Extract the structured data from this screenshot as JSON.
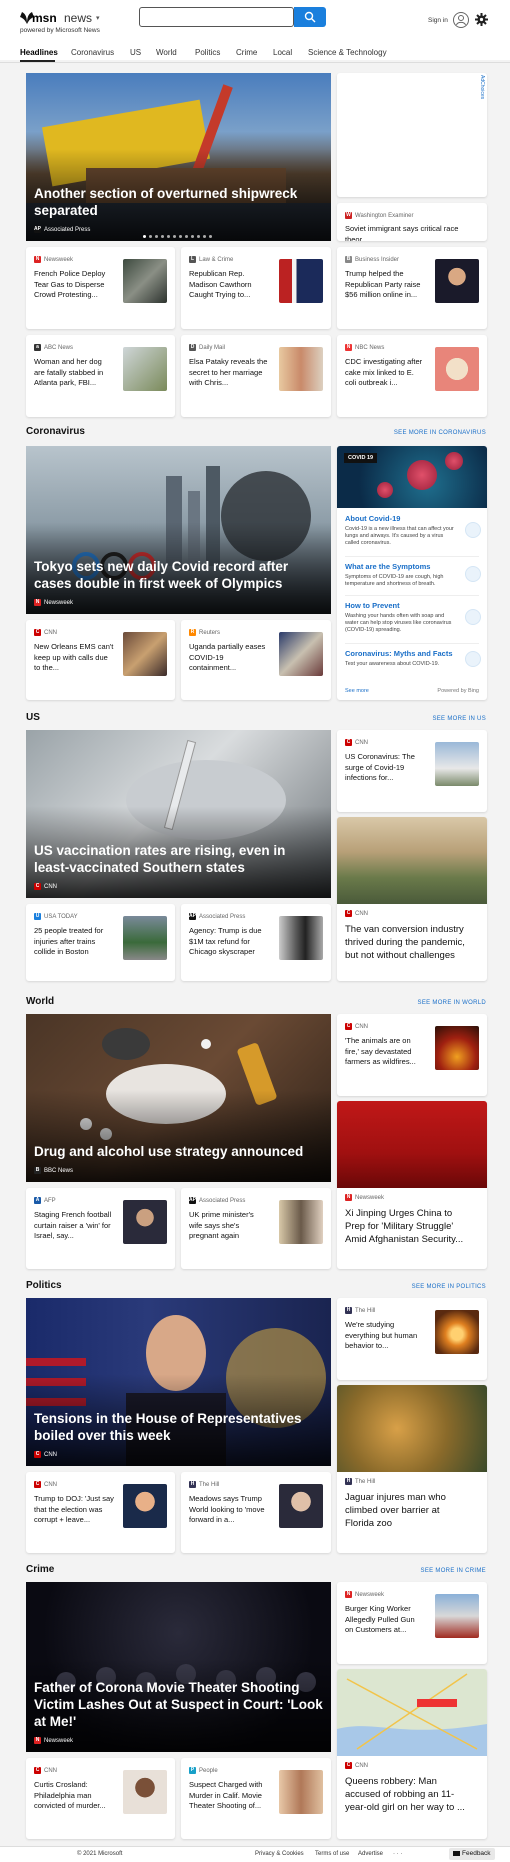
{
  "header": {
    "brand": "msn",
    "product": "news",
    "powered_by": "powered by Microsoft News",
    "search_placeholder": "",
    "sign_in": "Sign in"
  },
  "nav": [
    "Headlines",
    "Coronavirus",
    "US",
    "World",
    "Politics",
    "Crime",
    "Local",
    "Science & Technology"
  ],
  "ad_choices": "AdChoices",
  "top": {
    "hero_title": "Another section of overturned shipwreck separated",
    "hero_source": "Associated Press",
    "side_source": "Washington Examiner",
    "side_title": "Soviet immigrant says critical race theor...",
    "cards": [
      {
        "source": "Newsweek",
        "title": "French Police Deploy Tear Gas to Disperse Crowd Protesting..."
      },
      {
        "source": "Law & Crime",
        "title": "Republican Rep. Madison Cawthorn Caught Trying to..."
      },
      {
        "source": "Business Insider",
        "title": "Trump helped the Republican Party raise $56 million online in..."
      },
      {
        "source": "ABC News",
        "title": "Woman and her dog are fatally stabbed in Atlanta park, FBI..."
      },
      {
        "source": "Daily Mail",
        "title": "Elsa Pataky reveals the secret to her marriage with Chris..."
      },
      {
        "source": "NBC News",
        "title": "CDC investigating after cake mix linked to E. coli outbreak i..."
      }
    ]
  },
  "coronavirus": {
    "title": "Coronavirus",
    "see_more": "SEE MORE IN CORONAVIRUS",
    "hero_title": "Tokyo sets new daily Covid record after cases double in first week of Olympics",
    "hero_source": "Newsweek",
    "cards": [
      {
        "source": "CNN",
        "title": "New Orleans EMS can't keep up with calls due to the..."
      },
      {
        "source": "Reuters",
        "title": "Uganda partially eases COVID-19 containment..."
      }
    ],
    "panel": {
      "badge": "COVID 19",
      "items": [
        {
          "heading": "About Covid-19",
          "text": "Covid-19 is a new illness that can affect your lungs and airways. It's caused by a virus called coronavirus."
        },
        {
          "heading": "What are the Symptoms",
          "text": "Symptoms of COVID-19 are cough, high temperature and shortness of breath."
        },
        {
          "heading": "How to Prevent",
          "text": "Washing your hands often with soap and water can help stop viruses like coronavirus (COVID-19) spreading."
        },
        {
          "heading": "Coronavirus: Myths and Facts",
          "text": "Test your awareness about COVID-19."
        }
      ],
      "see_more": "See more",
      "powered": "Powered by Bing"
    }
  },
  "us": {
    "title": "US",
    "see_more": "SEE MORE IN US",
    "hero_title": "US vaccination rates are rising, even in least-vaccinated Southern states",
    "hero_source": "CNN",
    "side_card": {
      "source": "CNN",
      "title": "US Coronavirus: The surge of Covid-19 infections for..."
    },
    "tall_card": {
      "source": "CNN",
      "title": "The van conversion industry thrived during the pandemic, but not without challenges"
    },
    "cards": [
      {
        "source": "USA TODAY",
        "title": "25 people treated for injuries after trains collide in Boston"
      },
      {
        "source": "Associated Press",
        "title": "Agency: Trump is due $1M tax refund for Chicago skyscraper"
      }
    ]
  },
  "world": {
    "title": "World",
    "see_more": "SEE MORE IN WORLD",
    "hero_title": "Drug and alcohol use strategy announced",
    "hero_source": "BBC News",
    "side_card": {
      "source": "CNN",
      "title": "'The animals are on fire,' say devastated farmers as wildfires..."
    },
    "tall_card": {
      "source": "Newsweek",
      "title": "Xi Jinping Urges China to Prep for 'Military Struggle' Amid Afghanistan Security..."
    },
    "cards": [
      {
        "source": "AFP",
        "title": "Staging French football curtain raiser a 'win' for Israel, say..."
      },
      {
        "source": "Associated Press",
        "title": "UK prime minister's wife says she's pregnant again"
      }
    ]
  },
  "politics": {
    "title": "Politics",
    "see_more": "SEE MORE IN POLITICS",
    "hero_title": "Tensions in the House of Representatives boiled over this week",
    "hero_source": "CNN",
    "side_card": {
      "source": "The Hill",
      "title": "We're studying everything but human behavior to..."
    },
    "tall_card": {
      "source": "The Hill",
      "title": "Jaguar injures man who climbed over barrier at Florida zoo"
    },
    "cards": [
      {
        "source": "CNN",
        "title": "Trump to DOJ: 'Just say that the election was corrupt + leave..."
      },
      {
        "source": "The Hill",
        "title": "Meadows says Trump World looking to 'move forward in a..."
      }
    ]
  },
  "crime": {
    "title": "Crime",
    "see_more": "SEE MORE IN CRIME",
    "hero_title": "Father of Corona Movie Theater Shooting Victim Lashes Out at Suspect in Court: 'Look at Me!'",
    "hero_source": "Newsweek",
    "side_card": {
      "source": "Newsweek",
      "title": "Burger King Worker Allegedly Pulled Gun on Customers at..."
    },
    "tall_card": {
      "source": "CNN",
      "title": "Queens robbery: Man accused of robbing an 11-year-old girl on her way to ..."
    },
    "cards": [
      {
        "source": "CNN",
        "title": "Curtis Crosland: Philadelphia man convicted of murder..."
      },
      {
        "source": "People",
        "title": "Suspect Charged with Murder in Calif. Movie Theater Shooting of..."
      }
    ]
  },
  "footer": {
    "copyright": "© 2021 Microsoft",
    "privacy": "Privacy & Cookies",
    "terms": "Terms of use",
    "advertise": "Advertise",
    "more": "· · ·",
    "feedback": "Feedback"
  }
}
